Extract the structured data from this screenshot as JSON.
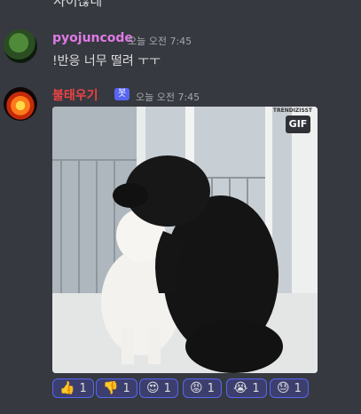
{
  "top_fragment": "사이잖네",
  "messages": [
    {
      "username": "pyojuncode",
      "timestamp": "오늘 오전 7:45",
      "text": "!반응 너무 떨려 ㅜㅜ",
      "name_color": "#e07ae6"
    },
    {
      "username": "불태우기",
      "badge": "봇",
      "timestamp": "오늘 오전 7:45",
      "name_color": "#ed4245",
      "gif": {
        "label": "GIF",
        "watermark": "TRENDIZISST"
      }
    }
  ],
  "reactions": [
    {
      "emoji": "👍",
      "icon": "thumbs-up-icon",
      "count": "1"
    },
    {
      "emoji": "👎",
      "icon": "thumbs-down-icon",
      "count": "1"
    },
    {
      "emoji": "😍",
      "icon": "heart-eyes-icon",
      "count": "1"
    },
    {
      "emoji": "😡",
      "icon": "angry-face-icon",
      "count": "1"
    },
    {
      "emoji": "😭",
      "icon": "crying-face-icon",
      "count": "1"
    },
    {
      "emoji": "😓",
      "icon": "sweat-face-icon",
      "count": "1"
    }
  ]
}
